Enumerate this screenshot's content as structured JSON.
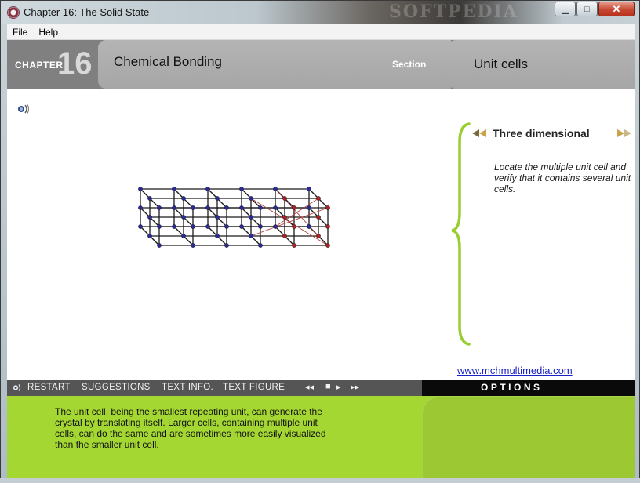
{
  "window": {
    "title": "Chapter 16: The Solid State",
    "watermark": "SOFTPEDIA",
    "controls": {
      "minimize": "▁",
      "maximize": "□",
      "close": "✕"
    }
  },
  "menu": {
    "items": [
      "File",
      "Help"
    ]
  },
  "header": {
    "chapter_word": "CHAPTER",
    "chapter_number": "16",
    "chapter_title": "Chemical Bonding",
    "section_word": "Section",
    "section_title": "Unit cells"
  },
  "panel": {
    "title": "Three dimensional",
    "text": "Locate the multiple unit cell and verify that it contains several unit cells.",
    "link": "www.mchmultimedia.com",
    "brace_color": "#9acd32"
  },
  "toolbar": {
    "restart": "RESTART",
    "suggestions": "SUGGESTIONS",
    "text_info": "TEXT INFO.",
    "text_figure": "TEXT FIGURE",
    "media": {
      "rewind": "◂◂",
      "stop": "■",
      "play": "▸",
      "forward": "▸▸"
    },
    "options": "OPTIONS"
  },
  "caption": "The unit cell, being the smallest repeating unit, can generate the crystal by translating itself.  Larger cells, containing multiple unit cells, can do the same and are sometimes more easily visualized than the smaller unit cell.",
  "colors": {
    "header_gray": "#808080",
    "tab_gray": "#a6a6a6",
    "toolbar_gray": "#555555",
    "options_black": "#0a0a0a",
    "bottom_green": "#a5d733",
    "link_blue": "#1a22c4",
    "atom_blue": "#2a2a9a",
    "atom_red": "#b02020"
  }
}
